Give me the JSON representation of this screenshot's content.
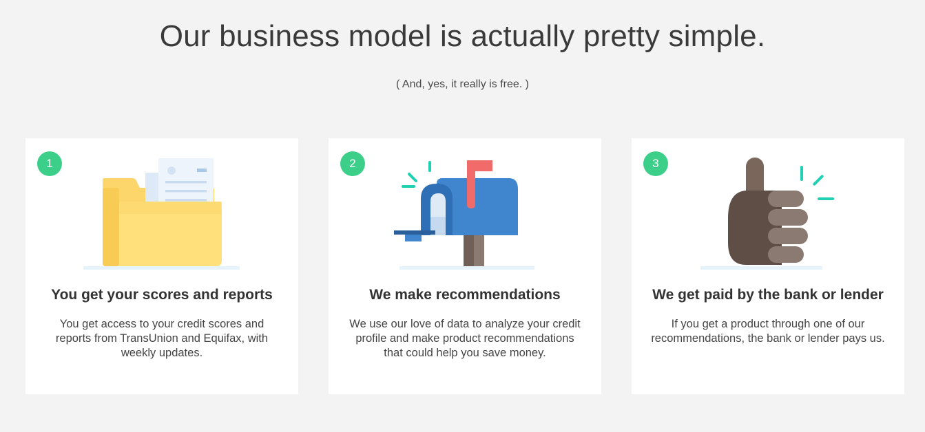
{
  "header": {
    "title": "Our business model is actually pretty simple.",
    "subtitle": "( And, yes, it really is free. )"
  },
  "steps": [
    {
      "number": "1",
      "icon": "folder-with-documents-icon",
      "title": "You get your scores and reports",
      "text": "You get access to your credit scores and reports from TransUnion and Equifax, with weekly updates."
    },
    {
      "number": "2",
      "icon": "mailbox-icon",
      "title": "We make recommendations",
      "text": "We use our love of data to analyze your credit profile and make product recommendations that could help you save money."
    },
    {
      "number": "3",
      "icon": "thumbs-up-icon",
      "title": "We get paid by the bank or lender",
      "text": "If you get a product through one of our recommendations, the bank or lender pays us."
    }
  ],
  "colors": {
    "page_background": "#f3f3f3",
    "card_background": "#ffffff",
    "badge": "#3ccf8a",
    "folder_yellow": "#fbd96a",
    "mailbox_blue": "#3f86cf",
    "flag_red": "#f26b6b",
    "accent_teal": "#1fd1b2",
    "hand_brown": "#6b5a50"
  }
}
